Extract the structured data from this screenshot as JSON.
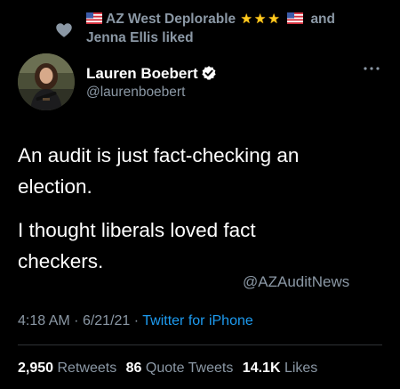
{
  "social_context": {
    "liker_one": "AZ West Deplorable",
    "connector": "and",
    "liker_two_line": "Jenna Ellis liked",
    "stars": [
      "★",
      "★",
      "★"
    ],
    "heart_icon": "heart-icon",
    "flag_icon": "us-flag-icon"
  },
  "author": {
    "name": "Lauren Boebert",
    "handle": "@laurenboebert",
    "verified": true,
    "verified_color": "#1d9bf0"
  },
  "tweet": {
    "line_one_a": "An audit is just fact-checking an",
    "line_one_b": "election.",
    "line_two_a": "I thought liberals loved fact",
    "line_two_b": "checkers."
  },
  "watermark": "@AZAuditNews",
  "meta": {
    "time": "4:18 AM",
    "sep1": "·",
    "date": "6/21/21",
    "sep2": "·",
    "source": "Twitter for iPhone"
  },
  "stats": {
    "retweets_count": "2,950",
    "retweets_label": "Retweets",
    "quotes_count": "86",
    "quotes_label": "Quote Tweets",
    "likes_count": "14.1K",
    "likes_label": "Likes"
  },
  "colors": {
    "background": "#000000",
    "text": "#ffffff",
    "muted": "#8b98a5",
    "link": "#1d9bf0",
    "star": "#ffcc1f"
  }
}
